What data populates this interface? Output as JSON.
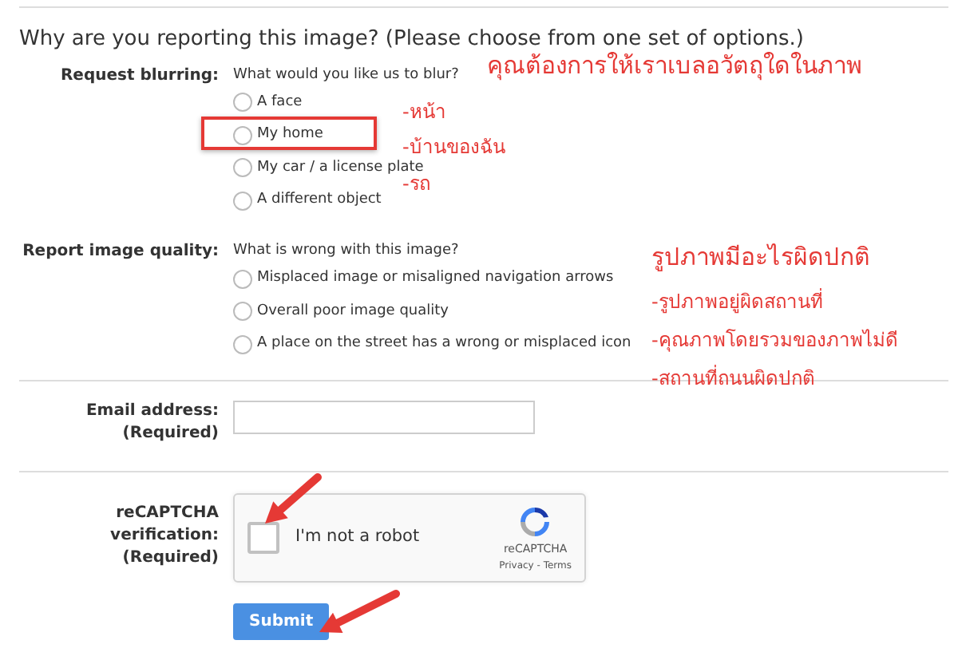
{
  "heading": "Why are you reporting this image?  (Please choose from one set of options.)",
  "sections": [
    {
      "label": "Request blurring:",
      "prompt": "What would you like us to blur?",
      "options": [
        {
          "label": "A face",
          "selected": false,
          "highlighted": false
        },
        {
          "label": "My home",
          "selected": false,
          "highlighted": true
        },
        {
          "label": "My car / a license plate",
          "selected": false,
          "highlighted": false
        },
        {
          "label": "A different object",
          "selected": false,
          "highlighted": false
        }
      ]
    },
    {
      "label": "Report image quality:",
      "prompt": "What is wrong with this image?",
      "options": [
        {
          "label": "Misplaced image or misaligned navigation arrows",
          "selected": false,
          "highlighted": false
        },
        {
          "label": "Overall poor image quality",
          "selected": false,
          "highlighted": false
        },
        {
          "label": "A place on the street has a wrong or misplaced icon",
          "selected": false,
          "highlighted": false
        }
      ]
    }
  ],
  "email": {
    "label": "Email address:",
    "required": "(Required)"
  },
  "recaptcha": {
    "label": "reCAPTCHA verification:",
    "required": "(Required)",
    "checked": false,
    "text": "I'm not a robot",
    "brand": "reCAPTCHA",
    "links": "Privacy - Terms"
  },
  "submit": "Submit",
  "annotations": [
    {
      "kind": "title",
      "text": "คุณต้องการให้เราเบลอวัตถุใดในภาพ"
    },
    {
      "kind": "item",
      "text": "-หน้า"
    },
    {
      "kind": "item",
      "text": "-บ้านของฉัน"
    },
    {
      "kind": "item",
      "text": "-รถ"
    },
    {
      "kind": "title",
      "text": "รูปภาพมีอะไรผิดปกติ"
    },
    {
      "kind": "item",
      "text": "-รูปภาพอยู่ผิดสถานที่"
    },
    {
      "kind": "item",
      "text": "-คุณภาพโดยรวมของภาพไม่ดี"
    },
    {
      "kind": "item",
      "text": "-สถานที่ถนนผิดปกติ"
    }
  ]
}
